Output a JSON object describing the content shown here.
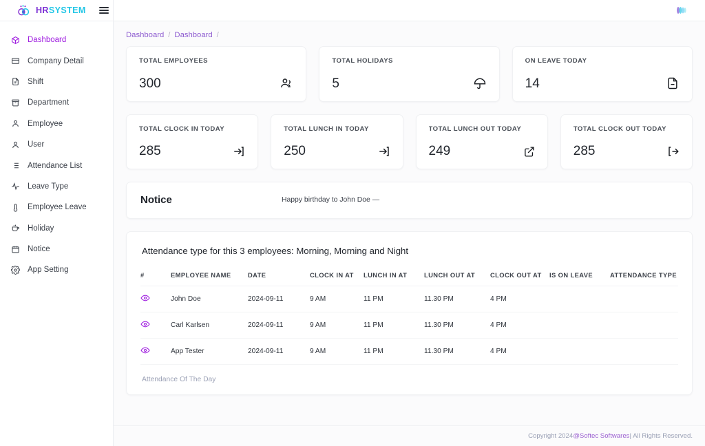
{
  "brand": {
    "hr": "HR",
    "system": "SYSTEM",
    "logo_icon": "hr-system-logo-icon",
    "menu_icon": "hamburger-menu-icon",
    "avatar_icon": "user-avatar-logo-icon",
    "accent_purple": "#a020e0",
    "accent_cyan": "#22c6e6"
  },
  "sidebar": {
    "items": [
      {
        "label": "Dashboard",
        "icon": "dashboard-icon",
        "active": true
      },
      {
        "label": "Company Detail",
        "icon": "building-icon",
        "active": false
      },
      {
        "label": "Shift",
        "icon": "file-text-icon",
        "active": false
      },
      {
        "label": "Department",
        "icon": "archive-box-icon",
        "active": false
      },
      {
        "label": "Employee",
        "icon": "person-icon",
        "active": false
      },
      {
        "label": "User",
        "icon": "person-icon",
        "active": false
      },
      {
        "label": "Attendance List",
        "icon": "list-icon",
        "active": false
      },
      {
        "label": "Leave Type",
        "icon": "activity-pulse-icon",
        "active": false
      },
      {
        "label": "Employee Leave",
        "icon": "thermometer-icon",
        "active": false
      },
      {
        "label": "Holiday",
        "icon": "coffee-cup-icon",
        "active": false
      },
      {
        "label": "Notice",
        "icon": "calendar-icon",
        "active": false
      },
      {
        "label": "App Setting",
        "icon": "gear-icon",
        "active": false
      }
    ]
  },
  "breadcrumb": {
    "first": "Dashboard",
    "second": "Dashboard",
    "sep": "/"
  },
  "stats_row1": [
    {
      "label": "TOTAL EMPLOYEES",
      "value": "300",
      "icon": "users-icon"
    },
    {
      "label": "TOTAL HOLIDAYS",
      "value": "5",
      "icon": "umbrella-icon"
    },
    {
      "label": "ON LEAVE TODAY",
      "value": "14",
      "icon": "file-minus-icon"
    }
  ],
  "stats_row2": [
    {
      "label": "TOTAL CLOCK IN TODAY",
      "value": "285",
      "icon": "log-in-icon"
    },
    {
      "label": "TOTAL LUNCH IN TODAY",
      "value": "250",
      "icon": "log-in-icon"
    },
    {
      "label": "TOTAL LUNCH OUT TODAY",
      "value": "249",
      "icon": "external-link-icon"
    },
    {
      "label": "TOTAL CLOCK OUT TODAY",
      "value": "285",
      "icon": "log-out-icon"
    }
  ],
  "notice": {
    "title": "Notice",
    "message": "Happy birthday to John Doe —"
  },
  "attendance": {
    "title": "Attendance type for this 3 employees: Morning, Morning and Night",
    "columns": [
      "#",
      "EMPLOYEE NAME",
      "DATE",
      "CLOCK IN AT",
      "LUNCH IN AT",
      "LUNCH OUT AT",
      "CLOCK OUT AT",
      "IS ON LEAVE",
      "ATTENDANCE TYPE"
    ],
    "rows": [
      {
        "icon": "eye-icon",
        "name": "John Doe",
        "date": "2024-09-11",
        "clock_in": "9 AM",
        "lunch_in": "11 PM",
        "lunch_out": "11.30 PM",
        "clock_out": "4 PM",
        "is_on_leave": "",
        "attendance_type": ""
      },
      {
        "icon": "eye-icon",
        "name": "Carl Karlsen",
        "date": "2024-09-11",
        "clock_in": "9 AM",
        "lunch_in": "11 PM",
        "lunch_out": "11.30 PM",
        "clock_out": "4 PM",
        "is_on_leave": "",
        "attendance_type": ""
      },
      {
        "icon": "eye-icon",
        "name": "App Tester",
        "date": "2024-09-11",
        "clock_in": "9 AM",
        "lunch_in": "11 PM",
        "lunch_out": "11.30 PM",
        "clock_out": "4 PM",
        "is_on_leave": "",
        "attendance_type": ""
      }
    ],
    "link": "Attendance Of The Day"
  },
  "footer": {
    "prefix": "Copyright 2024 ",
    "brand": "@Softec Softwares",
    "suffix": " | All Rights Reserved."
  }
}
